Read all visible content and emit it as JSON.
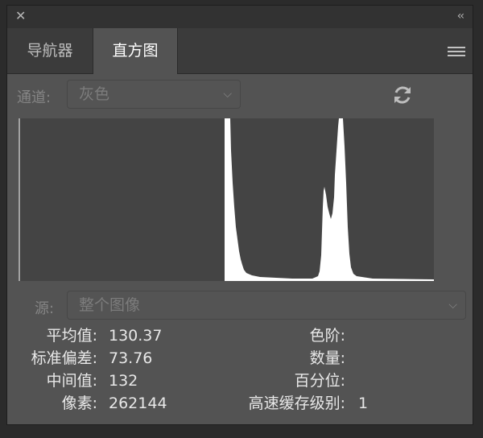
{
  "titlebar": {
    "close_glyph": "✕",
    "collapse_glyph": "‹‹"
  },
  "tabs": [
    {
      "label": "导航器",
      "active": false
    },
    {
      "label": "直方图",
      "active": true
    }
  ],
  "icons": {
    "close": "close-icon",
    "collapse": "double-chevron-left-icon",
    "menu": "hamburger-menu-icon",
    "refresh": "refresh-icon",
    "dropdown": "chevron-down-icon"
  },
  "channel": {
    "label": "通道:",
    "value": "灰色"
  },
  "source": {
    "label": "源:",
    "value": "整个图像"
  },
  "histogram_colors": {
    "background": "#444444",
    "bars": "#ffffff"
  },
  "stats": {
    "mean": {
      "label": "平均值:",
      "value": "130.37"
    },
    "std_dev": {
      "label": "标准偏差:",
      "value": "73.76"
    },
    "median": {
      "label": "中间值:",
      "value": "132"
    },
    "pixels": {
      "label": "像素:",
      "value": "262144"
    },
    "level": {
      "label": "色阶:",
      "value": ""
    },
    "count": {
      "label": "数量:",
      "value": ""
    },
    "percentile": {
      "label": "百分位:",
      "value": ""
    },
    "cache_level": {
      "label": "高速缓存级别:",
      "value": "1"
    }
  }
}
